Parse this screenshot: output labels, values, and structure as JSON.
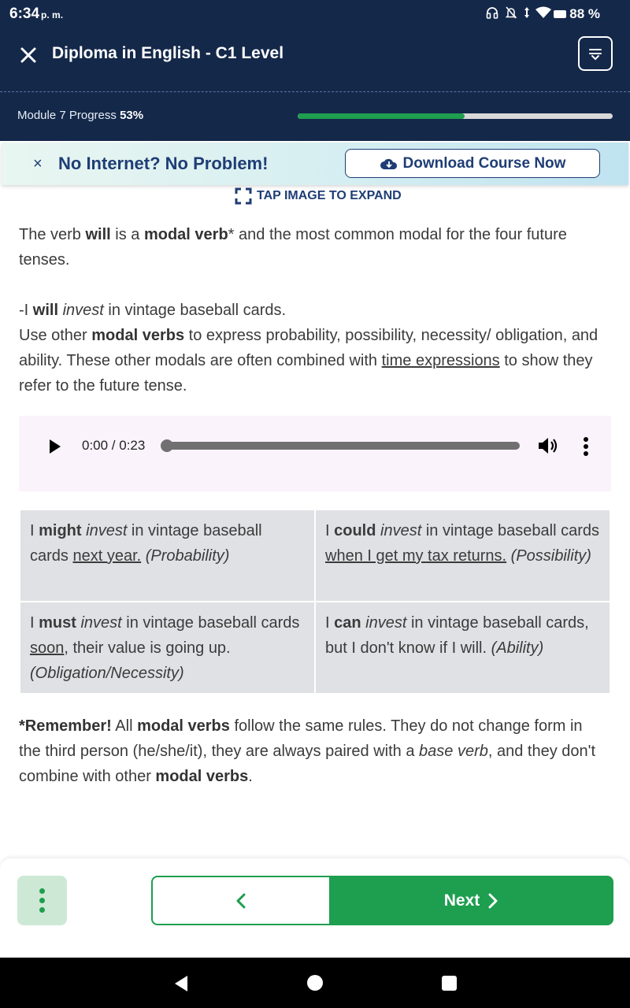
{
  "status_bar": {
    "time": "6:34",
    "time_suffix": "p. m.",
    "battery": "88 %",
    "icons": [
      "headset-icon",
      "notifications-off-icon",
      "data-arrows-icon",
      "wifi-icon",
      "battery-icon"
    ]
  },
  "header": {
    "title": "Diploma in English - C1 Level",
    "progress_label": "Module 7 Progress",
    "progress_value": "53%",
    "progress_fraction": 0.53
  },
  "banner": {
    "text": "No Internet? No Problem!",
    "button_label": "Download Course Now"
  },
  "content": {
    "tap_to_expand": "TAP IMAGE TO EXPAND",
    "p1": [
      "The verb ",
      "will",
      " is a ",
      "modal verb",
      "* and the most common modal for the four future tenses."
    ],
    "p2": [
      "-I ",
      "will",
      " ",
      "invest",
      " in vintage baseball cards.",
      "Use other ",
      "modal verbs",
      " to express probability, possibility, necessity/ obligation, and ability. These other modals are often combined with ",
      "time expressions",
      " to show they refer to the future tense."
    ],
    "audio": {
      "time": "0:00 / 0:23",
      "progress_fraction": 0.0
    },
    "table": [
      [
        "I ",
        "might",
        " ",
        "invest",
        " in vintage baseball cards ",
        "next year.",
        " ",
        "(Probability)"
      ],
      [
        "I ",
        "could",
        " ",
        "invest",
        " in vintage baseball cards ",
        "when I get my tax returns.",
        " ",
        "(Possibility)"
      ],
      [
        "I ",
        "must",
        " ",
        "invest",
        " in vintage baseball cards ",
        "soon",
        ", their value is going up. ",
        "(Obligation/Necessity)"
      ],
      [
        "I ",
        "can",
        " ",
        "invest",
        " in vintage baseball cards, but I don't know if I will. ",
        "",
        "",
        "(Ability)"
      ]
    ],
    "p3": [
      "*Remember!",
      " All ",
      "modal verbs",
      " follow the same rules.  They do not change form in the third person (he/she/it), they are always paired with a ",
      "base verb",
      ", and they don't combine with other ",
      "modal verbs",
      "."
    ]
  },
  "bottom_nav": {
    "next_label": "Next"
  },
  "colors": {
    "header_bg": "#142849",
    "accent_green": "#1e9e4f",
    "banner_text": "#1f3d75"
  }
}
